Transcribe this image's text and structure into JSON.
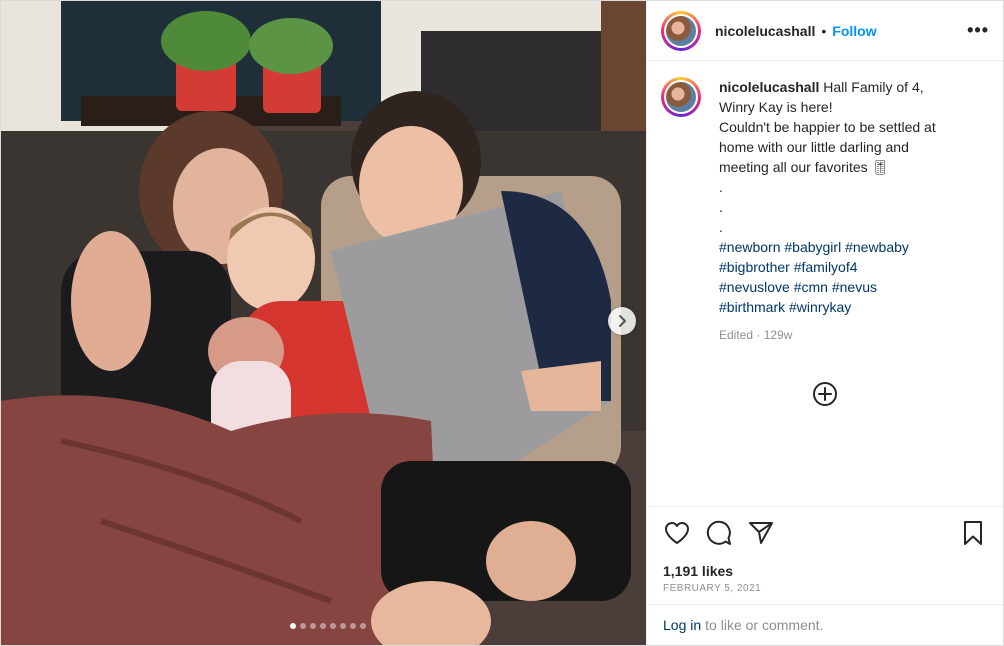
{
  "post": {
    "username": "nicolelucashall",
    "separator": "•",
    "follow_label": "Follow",
    "more_label": "•••"
  },
  "caption": {
    "username": "nicolelucashall",
    "line1": "Hall Family of 4,",
    "line2": "Winry Kay is here!",
    "line3": "Couldn't be happier to be settled at",
    "line4": "home with our little darling and",
    "line5": "meeting all our favorites 🎚",
    "dot1": ".",
    "dot2": ".",
    "dot3": ".",
    "hashtags_line1": "#newborn #babygirl #newbaby",
    "hashtags_line2": "#bigbrother #familyof4",
    "hashtags_line3": "#nevuslove #cmn #nevus",
    "hashtags_line4": "#birthmark #winrykay",
    "edited": "Edited",
    "age_sep": " · ",
    "age": "129w"
  },
  "carousel": {
    "total": 8,
    "active_index": 0
  },
  "actions": {
    "like_icon": "heart-icon",
    "comment_icon": "comment-icon",
    "share_icon": "paper-plane-icon",
    "save_icon": "bookmark-icon",
    "load_more_icon": "plus-circle-icon",
    "next_icon": "chevron-right-icon"
  },
  "stats": {
    "likes": "1,191 likes",
    "date": "FEBRUARY 5, 2021"
  },
  "login": {
    "link": "Log in",
    "text": "to like or comment."
  },
  "colors": {
    "link_blue": "#0095f6",
    "hashtag": "#00376b",
    "muted": "#8e8e8e",
    "text": "#262626"
  }
}
